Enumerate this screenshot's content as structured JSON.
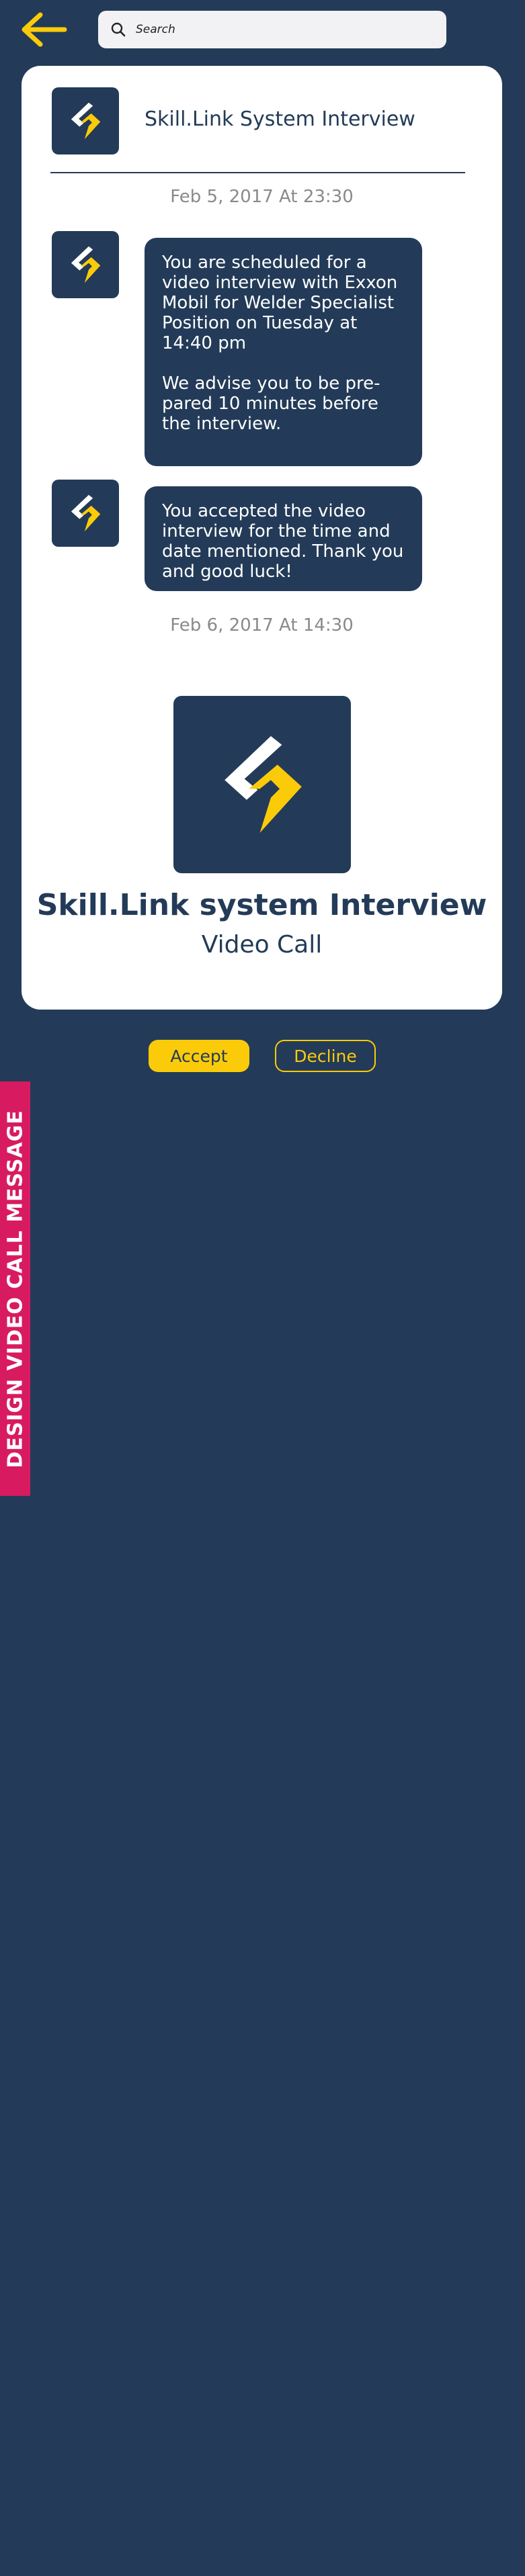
{
  "search": {
    "placeholder": "Search"
  },
  "conversation": {
    "title": "Skill.Link System Interview",
    "messages": [
      {
        "timestamp": "Feb 5, 2017 At 23:30",
        "paragraphs": [
          "You are scheduled for a video interview with Exxon Mobil for Welder Specialist Position on Tuesday at 14:40 pm",
          "We advise you to be pre-pared 10 minutes before the interview."
        ]
      },
      {
        "paragraphs": [
          "You accepted the video interview for the time and date mentioned. Thank you and good luck!"
        ]
      }
    ],
    "second_timestamp": "Feb 6, 2017 At 14:30"
  },
  "call": {
    "title": "Skill.Link system Interview",
    "subtitle": "Video Call"
  },
  "actions": {
    "accept_label": "Accept",
    "decline_label": "Decline"
  },
  "side_banner": {
    "text": "DESIGN VIDEO CALL MESSAGE"
  },
  "colors": {
    "background": "#233b58",
    "accent": "#fbcb0a",
    "banner": "#d81b60",
    "card": "#ffffff",
    "timestamp": "#8a8a8a"
  },
  "icons": [
    "back-arrow-icon",
    "search-icon",
    "skill-link-logo-icon"
  ]
}
